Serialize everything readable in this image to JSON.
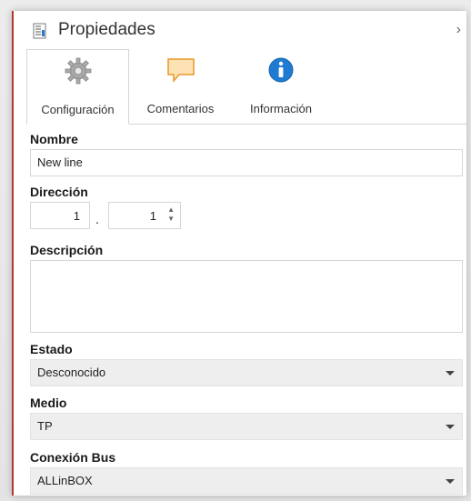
{
  "panel": {
    "title": "Propiedades",
    "collapse_glyph": "›"
  },
  "tabs": [
    {
      "label": "Configuración",
      "icon": "gear-icon",
      "active": true
    },
    {
      "label": "Comentarios",
      "icon": "comment-icon",
      "active": false
    },
    {
      "label": "Información",
      "icon": "info-icon",
      "active": false
    }
  ],
  "form": {
    "nombre": {
      "label": "Nombre",
      "value": "New line"
    },
    "direccion": {
      "label": "Dirección",
      "part1": "1",
      "separator": ".",
      "part2": "1"
    },
    "descripcion": {
      "label": "Descripción",
      "value": ""
    },
    "estado": {
      "label": "Estado",
      "value": "Desconocido"
    },
    "medio": {
      "label": "Medio",
      "value": "TP"
    },
    "conexion_bus": {
      "label": "Conexión Bus",
      "value": "ALLinBOX"
    }
  },
  "colors": {
    "accent_left_border": "#b23a2e",
    "info_icon": "#1f7bd1",
    "comment_icon": "#f4a52a"
  }
}
